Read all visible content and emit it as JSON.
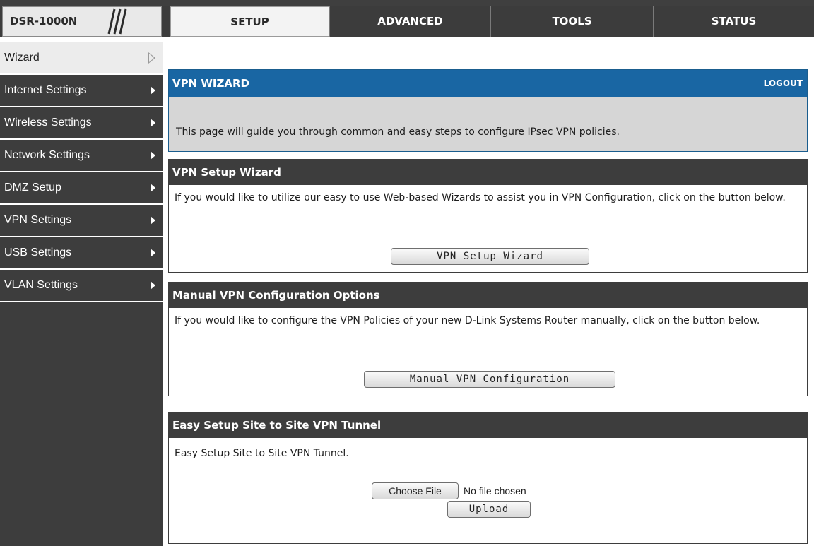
{
  "brand": {
    "model": "DSR-1000N"
  },
  "nav": {
    "tabs": [
      {
        "label": "SETUP",
        "active": true
      },
      {
        "label": "ADVANCED",
        "active": false
      },
      {
        "label": "TOOLS",
        "active": false
      },
      {
        "label": "STATUS",
        "active": false
      }
    ]
  },
  "sidebar": {
    "items": [
      {
        "label": "Wizard",
        "selected": true
      },
      {
        "label": "Internet Settings"
      },
      {
        "label": "Wireless Settings"
      },
      {
        "label": "Network Settings"
      },
      {
        "label": "DMZ Setup"
      },
      {
        "label": "VPN Settings"
      },
      {
        "label": "USB Settings"
      },
      {
        "label": "VLAN Settings"
      }
    ]
  },
  "wizard_panel": {
    "title": "VPN WIZARD",
    "logout": "LOGOUT",
    "description": "This page will guide you through common and easy steps to configure IPsec VPN policies."
  },
  "vpn_setup": {
    "title": "VPN Setup Wizard",
    "text": "If you would like to utilize our easy to use Web-based Wizards to assist you in VPN Configuration, click on the button below.",
    "button": "VPN Setup Wizard"
  },
  "manual_vpn": {
    "title": "Manual VPN Configuration Options",
    "text": "If you would like to configure the VPN Policies of your new D-Link Systems Router manually, click on the button below.",
    "button": "Manual VPN Configuration"
  },
  "easy_setup": {
    "title": "Easy Setup Site to Site VPN Tunnel",
    "text": "Easy Setup Site to Site VPN Tunnel.",
    "choose_button": "Choose File",
    "file_status": "No file chosen",
    "upload_button": "Upload"
  },
  "colors": {
    "nav_dark": "#3c3c3c",
    "wizard_header": "#1966a3",
    "wizard_body": "#d6d6d6"
  }
}
